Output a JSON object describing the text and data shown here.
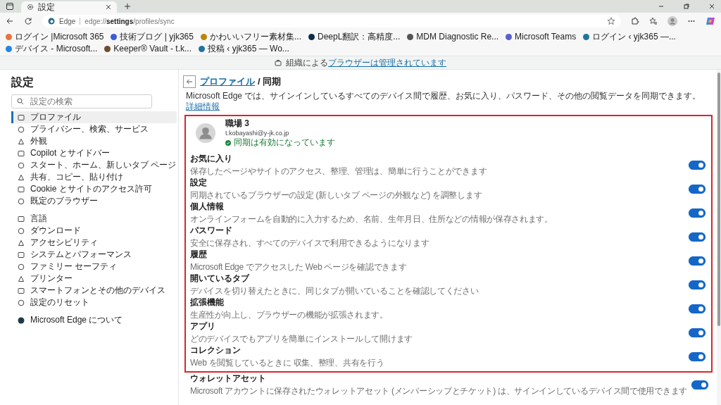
{
  "tab": {
    "title": "設定",
    "selected": true
  },
  "address_bar": {
    "site_label": "Edge",
    "url": "edge://**settings**/profiles/sync"
  },
  "bookmarks": [
    {
      "label": "ログイン |Microsoft 365",
      "color": "#e8743b"
    },
    {
      "label": "技術ブログ | yjk365",
      "color": "#3b5bdb"
    },
    {
      "label": "かわいいフリー素材集...",
      "color": "#b8860b"
    },
    {
      "label": "DeepL翻訳：高精度...",
      "color": "#0f2b46"
    },
    {
      "label": "MDM Diagnostic Re...",
      "color": "#555555"
    },
    {
      "label": "Microsoft Teams",
      "color": "#5b5fc7"
    },
    {
      "label": "ログイン ‹ yjk365 —...",
      "color": "#21759b"
    },
    {
      "label": "デバイス - Microsoft...",
      "color": "#1e88e5"
    },
    {
      "label": "Keeper® Vault - t.k...",
      "color": "#6d4c2f"
    },
    {
      "label": "投稿 ‹ yjk365 — Wo...",
      "color": "#21759b"
    }
  ],
  "managed_banner": {
    "text": "組織による",
    "link": "ブラウザーは管理されています"
  },
  "sidebar": {
    "title": "設定",
    "search": {
      "placeholder": "設定の検索"
    },
    "groups": [
      {
        "items": [
          {
            "label": "プロファイル",
            "selected": true
          },
          {
            "label": "プライバシー、検索、サービス",
            "selected": false
          },
          {
            "label": "外観",
            "selected": false
          },
          {
            "label": "Copilot とサイドバー",
            "selected": false
          },
          {
            "label": "スタート、ホーム、新しいタブ ページ",
            "selected": false
          },
          {
            "label": "共有、コピー、貼り付け",
            "selected": false
          },
          {
            "label": "Cookie とサイトのアクセス許可",
            "selected": false
          },
          {
            "label": "既定のブラウザー",
            "selected": false
          }
        ]
      },
      {
        "items": [
          {
            "label": "言語",
            "selected": false
          },
          {
            "label": "ダウンロード",
            "selected": false
          },
          {
            "label": "アクセシビリティ",
            "selected": false
          },
          {
            "label": "システムとパフォーマンス",
            "selected": false
          },
          {
            "label": "ファミリー セーフティ",
            "selected": false
          },
          {
            "label": "プリンター",
            "selected": false
          },
          {
            "label": "スマートフォンとその他のデバイス",
            "selected": false
          },
          {
            "label": "設定のリセット",
            "selected": false
          }
        ]
      },
      {
        "items": [
          {
            "label": "Microsoft Edge について",
            "selected": false
          }
        ]
      }
    ]
  },
  "page": {
    "breadcrumb_parent": "プロファイル",
    "breadcrumb_current": "/ 同期",
    "description": "Microsoft Edge では、サインインしているすべてのデバイス間で履歴、お気に入り、パスワード、その他の閲覧データを同期できます。",
    "learn_more": "詳細情報"
  },
  "profile": {
    "name": "職場 3",
    "email": "t.kobayashi@y-jk.co.jp",
    "status": "同期は有効になっています"
  },
  "sync_items": {
    "framed": [
      {
        "title": "お気に入り",
        "description": "保存したページやサイトのアクセス、整理、管理は、簡単に行うことができます",
        "on": true
      },
      {
        "title": "設定",
        "description": "同期されているブラウザーの設定 (新しいタブ ページの外観など) を調整します",
        "on": true
      },
      {
        "title": "個人情報",
        "description": "オンラインフォームを自動的に入力するため、名前、生年月日、住所などの情報が保存されます。",
        "on": true
      },
      {
        "title": "パスワード",
        "description": "安全に保存され、すべてのデバイスで利用できるようになります",
        "on": true
      },
      {
        "title": "履歴",
        "description": "Microsoft Edge でアクセスした Web ページを確認できます",
        "on": true
      },
      {
        "title": "開いているタブ",
        "description": "デバイスを切り替えたときに、同じタブが開いていることを確認してください",
        "on": true
      },
      {
        "title": "拡張機能",
        "description": "生産性が向上し、ブラウザーの機能が拡張されます。",
        "on": true
      },
      {
        "title": "アプリ",
        "description": "どのデバイスでもアプリを簡単にインストールして開けます",
        "on": true
      },
      {
        "title": "コレクション",
        "description": "Web を閲覧しているときに 収集、整理、共有を行う",
        "on": true
      }
    ],
    "below": [
      {
        "title": "ウォレットアセット",
        "description": "Microsoft アカウントに保存されたウォレットアセット (メンバーシップとチケット) は、サインインしているデバイス間で使用できます",
        "on": true
      }
    ]
  }
}
